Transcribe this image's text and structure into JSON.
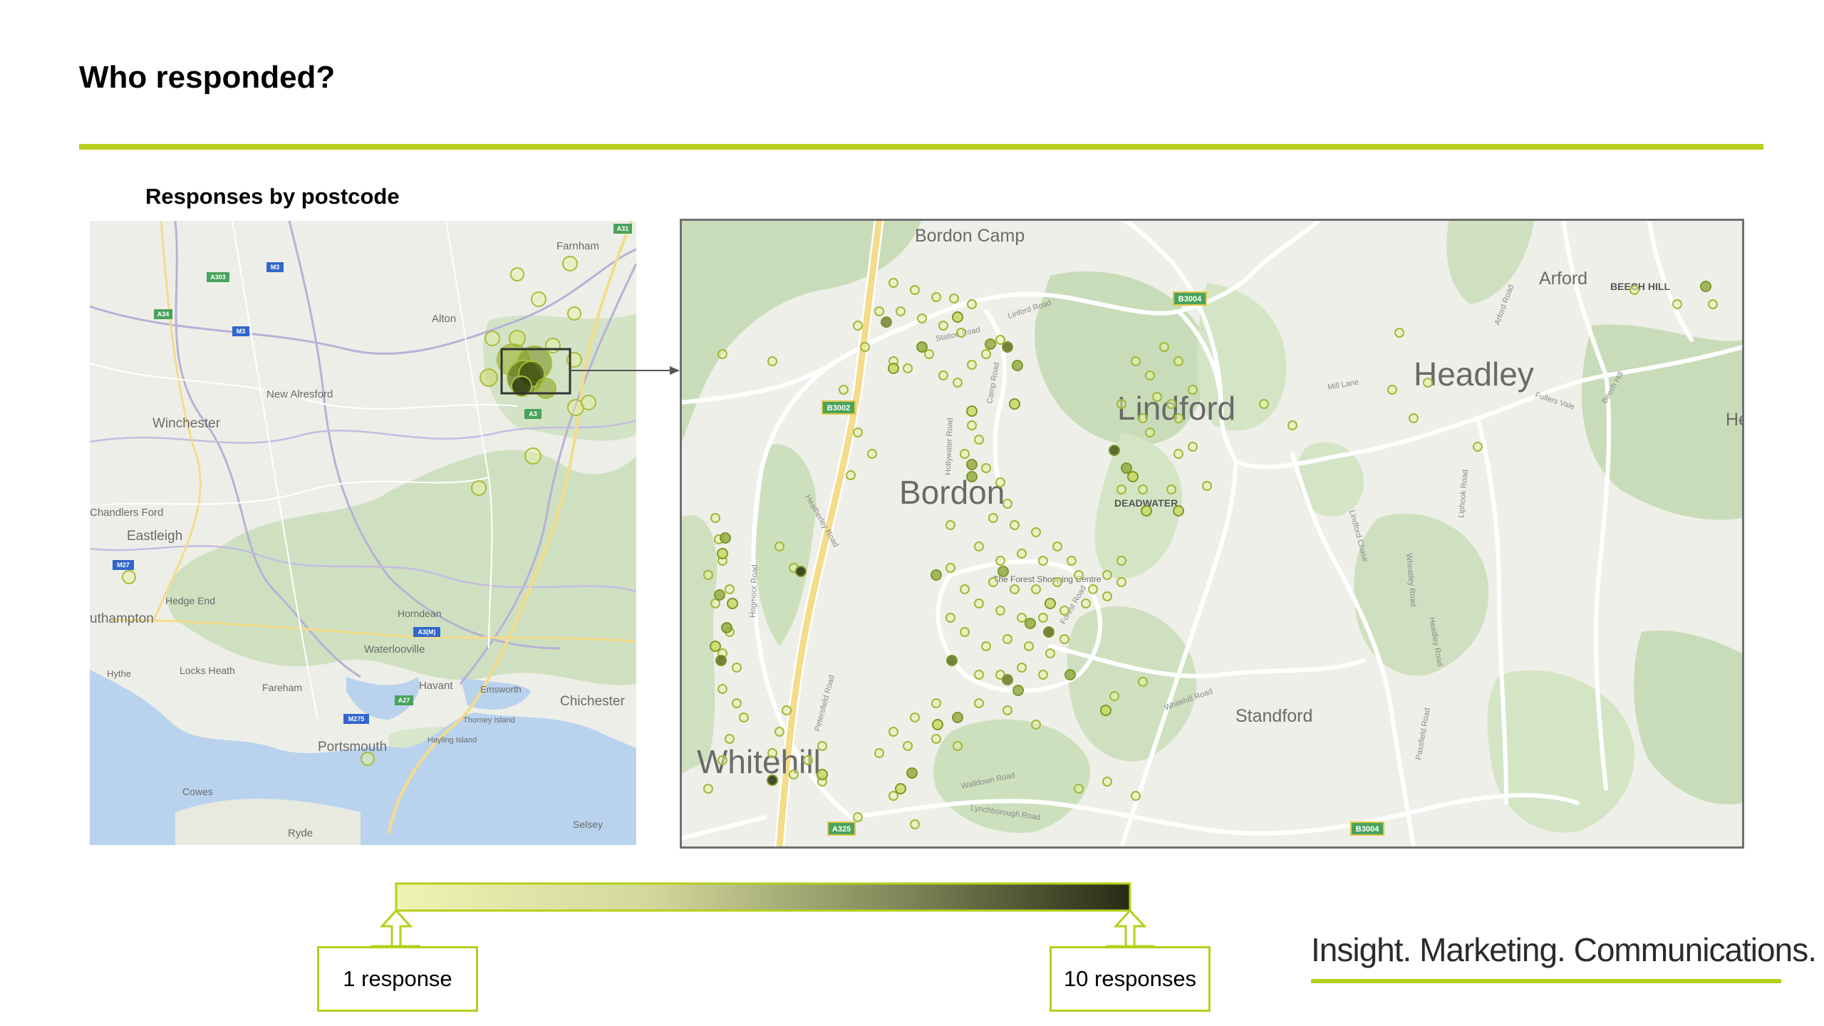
{
  "title": "Who responded?",
  "subtitle": "Responses by postcode",
  "colors": {
    "accent": "#b5cf1a",
    "water": "#b9d3ee",
    "land": "#eeeee8",
    "green_area": "#c7dcb8",
    "major_road": "#f3dc8a",
    "minor_road": "#ffffff",
    "county_road": "#b9b0d6",
    "marker_light": "#e8f0a8",
    "marker_dark": "#2d3a12"
  },
  "overview_map": {
    "place_labels": [
      "Farnham",
      "Alton",
      "New Alresford",
      "Winchester",
      "Chandlers Ford",
      "Eastleigh",
      "Hedge End",
      "uthampton",
      "Horndean",
      "Waterlooville",
      "Locks Heath",
      "Fareham",
      "Havant",
      "Emsworth",
      "Chichester",
      "Hythe",
      "Portsmouth",
      "Hayling Island",
      "Thorney Island",
      "Cowes",
      "Ryde",
      "Selsey"
    ],
    "road_shields": [
      "A31",
      "A303",
      "M3",
      "A34",
      "M3",
      "A3",
      "M27",
      "A3(M)",
      "A27",
      "M275"
    ]
  },
  "detail_map": {
    "place_labels": [
      "Bordon Camp",
      "Arford",
      "BEECH HILL",
      "Headley",
      "He",
      "Lindford",
      "Bordon",
      "DEADWATER",
      "Standford",
      "Whitehill",
      "The Forest Shopping Centre"
    ],
    "road_labels": [
      "Station Road",
      "Linford Road",
      "Camp Road",
      "Mill Lane",
      "Liphook Road",
      "Whitehill Road",
      "Walldown Road",
      "Lynchborough Road",
      "Petersfield Road",
      "Hogmoor Road",
      "Headley Road",
      "Passfield Road",
      "Arford Road",
      "Fullers Vale",
      "Beech Hill",
      "Lindford Chase",
      "Wheatley Road",
      "Heatherley Road",
      "Hollywater Road",
      "Forest Road"
    ],
    "road_shields": [
      "B3004",
      "B3002",
      "A325",
      "B3004"
    ]
  },
  "legend": {
    "min_label": "1 response",
    "max_label": "10 responses",
    "min_value": 1,
    "max_value": 10,
    "gradient_start": "#eef3b4",
    "gradient_end": "#262c14"
  },
  "tagline": "Insight. Marketing. Communications."
}
